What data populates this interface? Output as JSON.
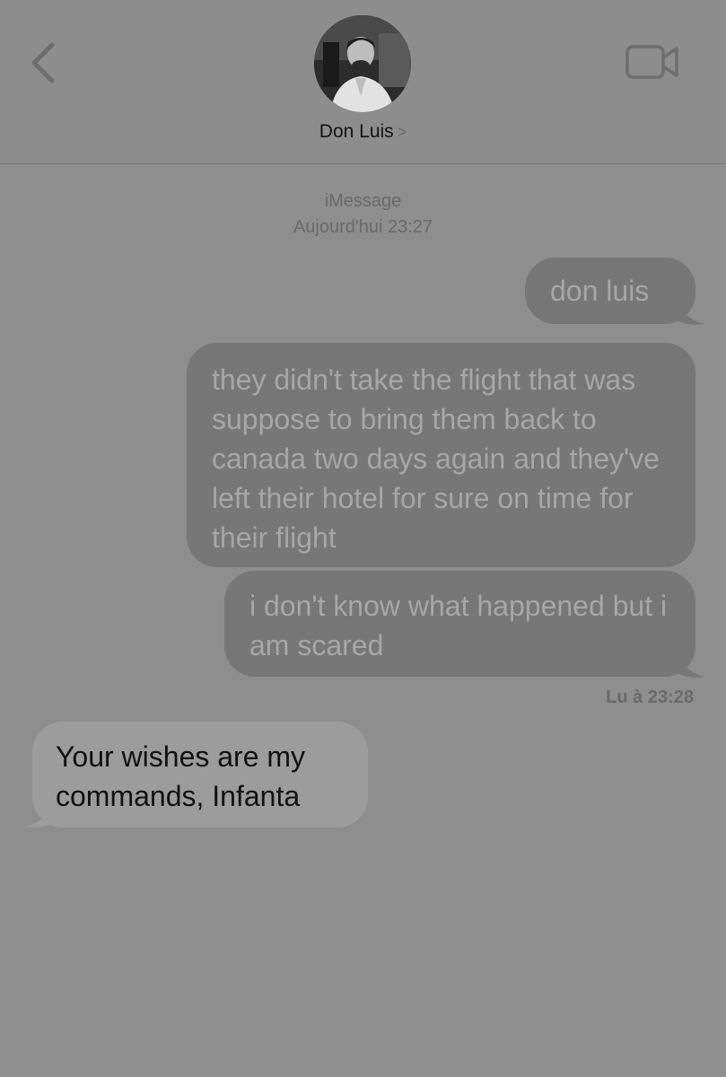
{
  "header": {
    "back_icon": "chevron-left-icon",
    "video_icon": "video-camera-icon",
    "contact_name": "Don Luis",
    "contact_chevron": ">"
  },
  "thread": {
    "service": "iMessage",
    "timestamp": "Aujourd'hui 23:27"
  },
  "messages": [
    {
      "direction": "outgoing",
      "text": "don luis"
    },
    {
      "direction": "outgoing",
      "text": "they didn't take the flight that was suppose to bring them back to canada two days again and they've left their hotel for sure on time for their flight"
    },
    {
      "direction": "outgoing",
      "text": "i don't know what happened but i am scared"
    },
    {
      "direction": "incoming",
      "text": "Your wishes are my commands, Infanta"
    }
  ],
  "read_receipt": "Lu à 23:28",
  "colors": {
    "background": "#8e8e8e",
    "outgoing_bubble": "#777777",
    "incoming_bubble": "#9c9c9c"
  }
}
